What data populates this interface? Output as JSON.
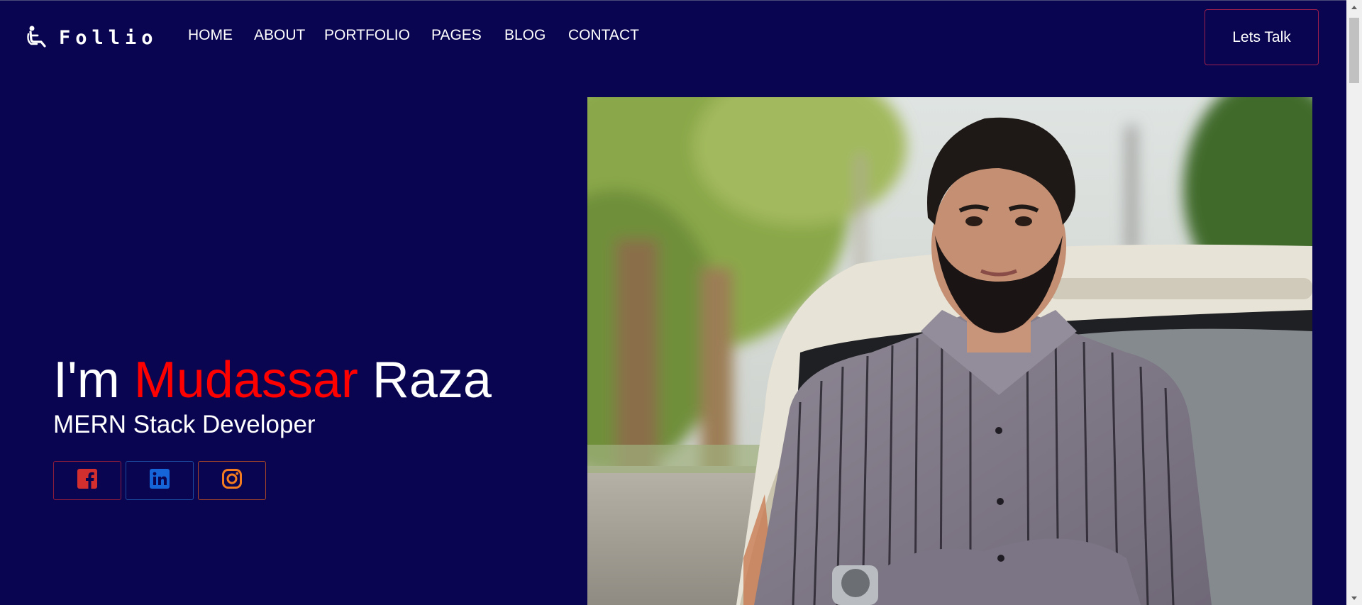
{
  "brand": {
    "name": "Follio",
    "icon": "seated-person-icon"
  },
  "nav": {
    "items": [
      {
        "label": "HOME"
      },
      {
        "label": "ABOUT"
      },
      {
        "label": "PORTFOLIO"
      },
      {
        "label": "PAGES"
      },
      {
        "label": "BLOG"
      },
      {
        "label": "CONTACT"
      }
    ],
    "cta_label": "Lets Talk"
  },
  "hero": {
    "title_prefix": "I'm",
    "title_first": "Mudassar",
    "title_last": "Raza",
    "subtitle": "MERN Stack Developer",
    "socials": [
      {
        "name": "facebook",
        "icon": "facebook-icon",
        "color": "#d32f2f"
      },
      {
        "name": "linkedin",
        "icon": "linkedin-icon",
        "color": "#1565d8"
      },
      {
        "name": "instagram",
        "icon": "instagram-icon",
        "color": "#f47c20"
      }
    ]
  },
  "colors": {
    "background": "#090550",
    "accent": "#ff0000",
    "cta_border": "#9c1f4e"
  }
}
